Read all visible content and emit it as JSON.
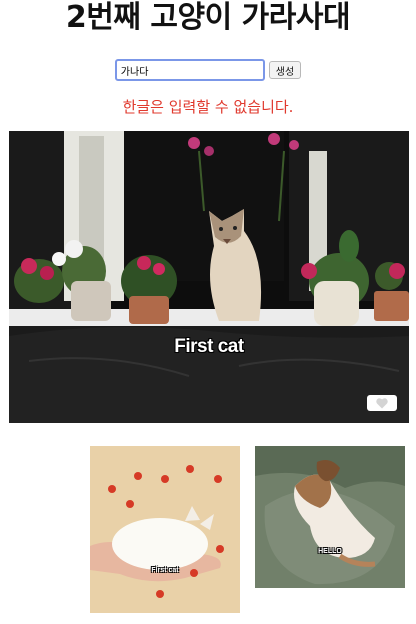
{
  "page": {
    "title": "2번째 고양이 가라사대"
  },
  "form": {
    "input_value": "가나다",
    "submit_label": "생성"
  },
  "error": {
    "message": "한글은 입력할 수 없습니다."
  },
  "hero": {
    "caption": "First cat",
    "like_icon": "heart-icon"
  },
  "gallery": {
    "items": [
      {
        "caption": "First cat"
      },
      {
        "caption": "HELLO"
      }
    ]
  },
  "colors": {
    "error": "#e0392e",
    "input_border": "#7b97e8"
  }
}
